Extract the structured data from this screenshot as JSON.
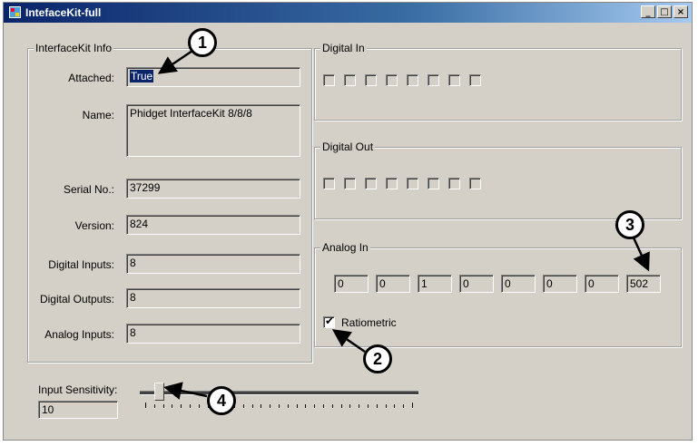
{
  "window": {
    "title": "IntefaceKit-full",
    "minimize": "_",
    "maximize": "□",
    "close": "×"
  },
  "info": {
    "group_label": "InterfaceKit Info",
    "attached_label": "Attached:",
    "attached_value": "True",
    "name_label": "Name:",
    "name_value": "Phidget InterfaceKit 8/8/8",
    "serial_label": "Serial No.:",
    "serial_value": "37299",
    "version_label": "Version:",
    "version_value": "824",
    "din_label": "Digital Inputs:",
    "din_value": "8",
    "dout_label": "Digital Outputs:",
    "dout_value": "8",
    "ain_label": "Analog Inputs:",
    "ain_value": "8"
  },
  "digital_in": {
    "label": "Digital In",
    "states": [
      false,
      false,
      false,
      false,
      false,
      false,
      false,
      false
    ]
  },
  "digital_out": {
    "label": "Digital Out",
    "states": [
      false,
      false,
      false,
      false,
      false,
      false,
      false,
      false
    ]
  },
  "analog_in": {
    "label": "Analog In",
    "values": [
      "0",
      "0",
      "1",
      "0",
      "0",
      "0",
      "0",
      "502"
    ],
    "ratiometric_label": "Ratiometric",
    "ratiometric_checked": true
  },
  "sensitivity": {
    "label": "Input Sensitivity:",
    "value": "10",
    "slider_fraction": 0.05
  },
  "callouts": [
    "1",
    "2",
    "3",
    "4"
  ]
}
